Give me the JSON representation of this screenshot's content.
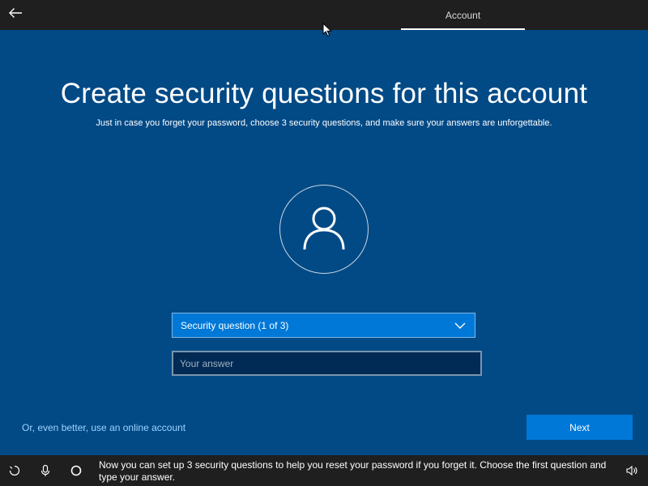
{
  "topbar": {
    "back_icon": "back-arrow-icon",
    "tab_label": "Account"
  },
  "main": {
    "heading": "Create security questions for this account",
    "subheading": "Just in case you forget your password, choose 3 security questions, and make sure your answers are unforgettable.",
    "avatar_icon": "user-icon",
    "question_dropdown": {
      "selected": "Security question (1 of 3)",
      "icon": "chevron-down-icon"
    },
    "answer_input": {
      "value": "",
      "placeholder": "Your answer"
    },
    "online_account_link": "Or, even better, use an online account",
    "next_label": "Next"
  },
  "bottombar": {
    "icons": [
      "ease-of-access-icon",
      "microphone-icon",
      "cortana-icon",
      "volume-icon"
    ],
    "caption": "Now you can set up 3 security questions to help you reset your password if you forget it. Choose the first question and type your answer."
  },
  "colors": {
    "background": "#024a86",
    "bars": "#1f1f1f",
    "accent": "#0078d7",
    "link": "#9cd3ff",
    "input_background": "#012b55"
  }
}
